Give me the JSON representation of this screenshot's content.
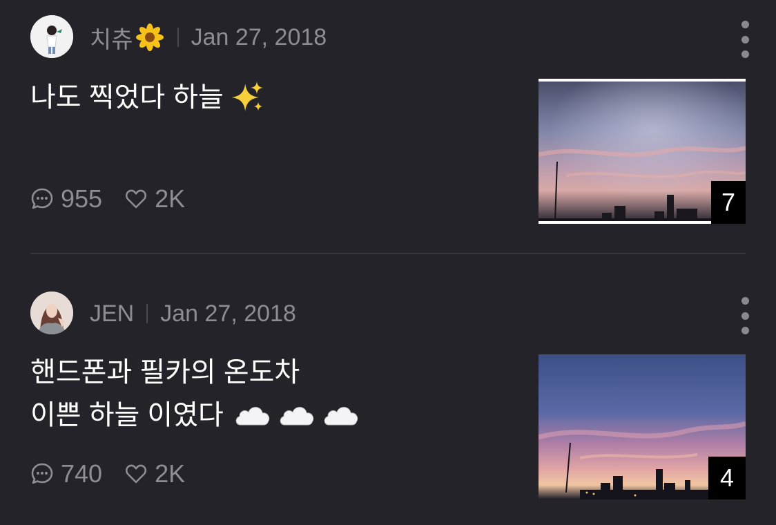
{
  "posts": [
    {
      "author": "치츄",
      "date": "Jan 27, 2018",
      "text_lines": [
        "나도 찍었다 하늘"
      ],
      "trailing_emoji": "sparkles",
      "comments": "955",
      "likes": "2K",
      "photo_count": "7"
    },
    {
      "author": "JEN",
      "date": "Jan 27, 2018",
      "text_lines": [
        "핸드폰과 필카의 온도차",
        "이쁜 하늘 이였다"
      ],
      "trailing_emoji": "cloud x3",
      "comments": "740",
      "likes": "2K",
      "photo_count": "4"
    }
  ],
  "icons": {
    "author_badge": "sunflower-emoji",
    "comment": "speech-bubble-icon",
    "like": "heart-outline-icon",
    "more": "vertical-ellipsis-icon"
  },
  "colors": {
    "background": "#242329",
    "meta_text": "#8e8d95",
    "body_text": "#ffffff",
    "divider": "#38373e"
  }
}
